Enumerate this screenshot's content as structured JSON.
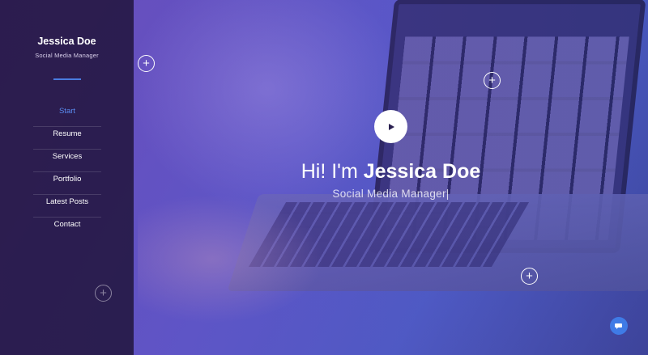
{
  "sidebar": {
    "name": "Jessica Doe",
    "role": "Social Media Manager",
    "nav": [
      {
        "label": "Start"
      },
      {
        "label": "Resume"
      },
      {
        "label": "Services"
      },
      {
        "label": "Portfolio"
      },
      {
        "label": "Latest Posts"
      },
      {
        "label": "Contact"
      }
    ]
  },
  "hero": {
    "greeting": "Hi! I'm ",
    "name": "Jessica Doe",
    "subtitle": "Social Media Manager|"
  },
  "icons": {
    "plus": "plus-icon",
    "play": "play-icon",
    "chat": "chat-icon"
  },
  "colors": {
    "accent": "#4a7ce0",
    "sidebar_bg": "#1e1237",
    "chat_button": "#3f7be6"
  }
}
